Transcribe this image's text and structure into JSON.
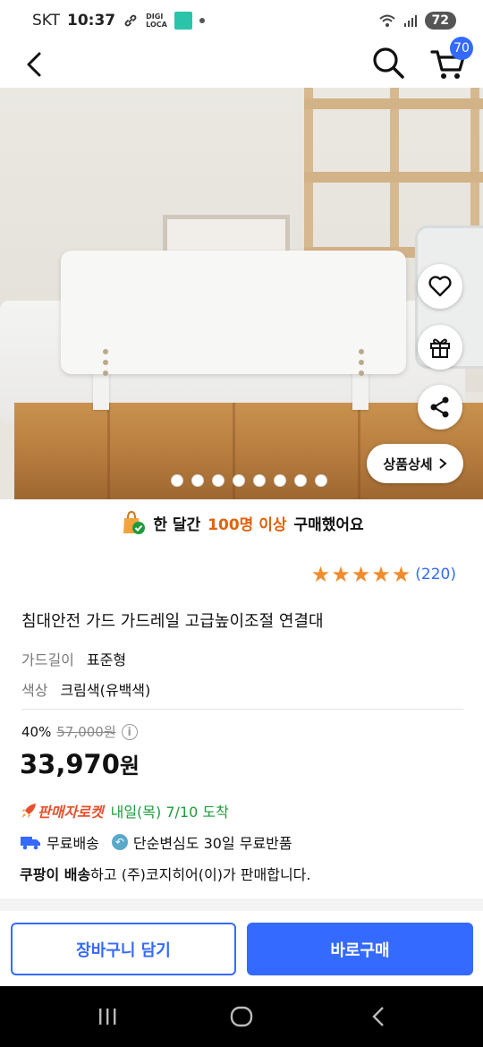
{
  "status_bar": {
    "carrier": "SKT",
    "time": "10:37",
    "digi_label_1": "DIGI",
    "digi_label_2": "LOCA",
    "battery": "72"
  },
  "nav": {
    "cart_count": "70"
  },
  "hero": {
    "detail_label": "상품상세",
    "slide_count": 8
  },
  "purchase_banner": {
    "prefix": "한 달간",
    "highlight": "100명 이상",
    "suffix": "구매했어요"
  },
  "rating": {
    "stars": 5,
    "count": "(220)"
  },
  "product": {
    "title": "침대안전 가드 가드레일 고급높이조절 연결대",
    "options": [
      {
        "label": "가드길이",
        "value": "표준형"
      },
      {
        "label": "색상",
        "value": "크림색(유백색)"
      }
    ]
  },
  "price": {
    "discount": "40%",
    "original": "57,000원",
    "info_icon": "i",
    "amount": "33,970",
    "unit": "원"
  },
  "delivery": {
    "rocket": "판매자로켓",
    "arrival": "내일(목) 7/10 도착",
    "free_shipping": "무료배송",
    "return_policy": "단순변심도 30일 무료반품",
    "seller_brand": "쿠팡이 배송",
    "seller_text": "하고 (주)코지히어(이)가 판매합니다."
  },
  "actions": {
    "add_to_cart": "장바구니 담기",
    "buy_now": "바로구매"
  },
  "colors": {
    "accent": "#346aff",
    "orange": "#e0620d",
    "green": "#1e9b3c",
    "star": "#f28b2c"
  }
}
